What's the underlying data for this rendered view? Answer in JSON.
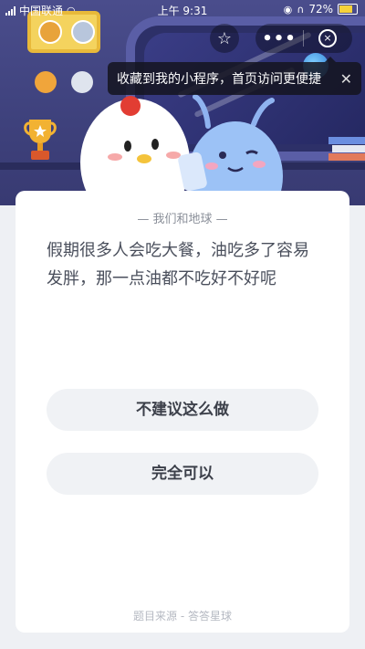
{
  "status_bar": {
    "carrier": "中国联通",
    "time": "上午 9:31",
    "battery": "72%"
  },
  "capsule": {
    "menu_label": "•••",
    "close_label": "×"
  },
  "tip": {
    "text": "收藏到我的小程序，首页访问更便捷",
    "close_label": "✕"
  },
  "card": {
    "subtitle": "— 我们和地球 —",
    "question": "假期很多人会吃大餐，油吃多了容易发胖，那一点油都不吃好不好呢",
    "options": [
      {
        "label": "不建议这么做"
      },
      {
        "label": "完全可以"
      }
    ],
    "source": "题目来源 - 答答星球"
  },
  "colors": {
    "hero_bg": "#4a4d8c",
    "card_bg": "#ffffff",
    "option_bg": "#f0f2f5",
    "page_bg": "#eef0f4"
  },
  "icons": [
    "wifi-icon",
    "location-icon",
    "headphones-icon",
    "battery-icon",
    "star-icon",
    "medal-icon",
    "trophy-icon",
    "close-icon"
  ]
}
